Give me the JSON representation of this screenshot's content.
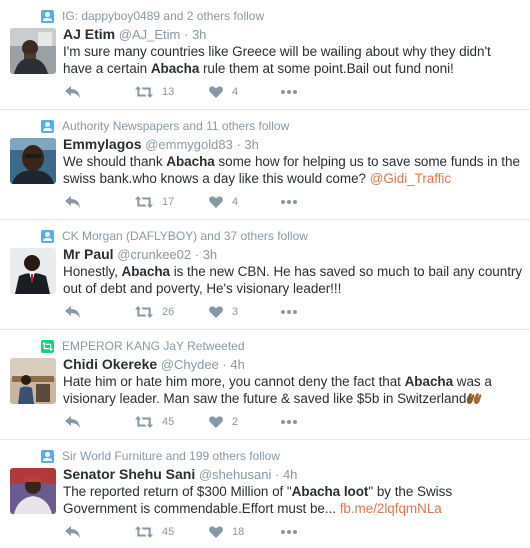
{
  "colors": {
    "accent": "#55acee",
    "retweet": "#19cf86",
    "link": "#e0774d",
    "muted": "#8899a6"
  },
  "tweets": [
    {
      "context_icon": "follow-icon",
      "context": "IG: dappyboy0489 and 2 others follow",
      "fullname": "AJ Etim",
      "username": "@AJ_Etim",
      "time": "3h",
      "text_before": "I'm sure many countries like Greece will be wailing about why they didn't have a certain ",
      "bold": "Abacha",
      "text_after": " rule them at some point.Bail out fund noni!",
      "link": "",
      "retweets": "13",
      "likes": "4"
    },
    {
      "context_icon": "follow-icon",
      "context": "Authority Newspapers and 11 others follow",
      "fullname": "Emmylagos",
      "username": "@emmygold83",
      "time": "3h",
      "text_before": "We should thank ",
      "bold": "Abacha",
      "text_after": " some how for helping us to save some funds in the swiss bank.who knows a day like this would come? ",
      "link": "@Gidi_Traffic",
      "retweets": "17",
      "likes": "4"
    },
    {
      "context_icon": "follow-icon",
      "context": "CK Morgan (DAFLYBOY) and 37 others follow",
      "fullname": "Mr Paul",
      "username": "@crunkee02",
      "time": "3h",
      "text_before": "Honestly, ",
      "bold": "Abacha",
      "text_after": " is the new CBN. He has saved so much to bail any country out of debt and poverty, He's visionary leader!!!",
      "link": "",
      "retweets": "26",
      "likes": "3"
    },
    {
      "context_icon": "retweet-icon",
      "context": "EMPEROR KANG JaY Retweeted",
      "fullname": "Chidi Okereke",
      "username": "@Chydee",
      "time": "4h",
      "text_before": "Hate him or hate him more, you cannot deny the fact that ",
      "bold": "Abacha",
      "text_after": " was a visionary leader. Man saw the future & saved like $5b in Switzerland",
      "link": "",
      "retweets": "45",
      "likes": "2"
    },
    {
      "context_icon": "follow-icon",
      "context": "Sir World Furniture and 199 others follow",
      "fullname": "Senator Shehu Sani",
      "username": "@shehusani",
      "time": "4h",
      "text_before": "The reported return of $300 Million of \"",
      "bold": "Abacha loot",
      "text_after": "\" by the Swiss Government is commendable.Effort must be... ",
      "link": "fb.me/2lqfqmNLa",
      "retweets": "45",
      "likes": "18"
    }
  ]
}
